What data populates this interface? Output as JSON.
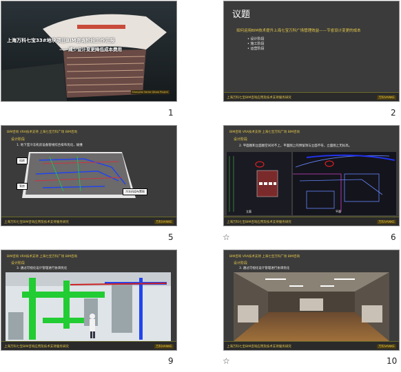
{
  "slides": [
    {
      "number": "1",
      "title_line1": "上海万科七宝33#地块项目BIM咨询阶段工作汇报",
      "title_line2": "——减少设计变更降低成本费用",
      "logo_text": "Shanghai Vanke Qibao Project"
    },
    {
      "number": "2",
      "heading": "议题",
      "subtitle": "如何运用BIM技术提升上海七宝万科广场管理效益——节省设计变更的成本",
      "bullets": [
        "设计阶段",
        "施工阶段",
        "运营阶段"
      ],
      "footer": "上海万科七宝BIM咨询应用及技术支持服务研究",
      "footer_logo": "万科VANKE"
    },
    {
      "number": "5",
      "topbar": "BIM咨询 VRA技术支持 上海七宝万科广场 BIM咨询",
      "section": "设计阶段",
      "note": "1. 地下室冷冻机房设备管线综合排布优化，碰撞",
      "callouts": [
        "机房",
        "泵房",
        "冷冻机组布置图"
      ],
      "footer": "上海万科七宝BIM咨询应用及技术支持服务研究",
      "footer_logo": "万科VANKE"
    },
    {
      "number": "6",
      "topbar": "BIM咨询 VRA技术支持 上海七宝万科广场 BIM咨询",
      "section": "设计阶段",
      "note": "2. 平面图和立面图空间对不上，平面图上的预留洞与立面不符，立面图上无标高。",
      "label_left": "立面",
      "label_right": "平面",
      "footer": "上海万科七宝BIM咨询应用及技术支持服务研究",
      "footer_logo": "万科VANKE"
    },
    {
      "number": "9",
      "topbar": "BIM咨询 VRA技术支持 上海七宝万科广场 BIM咨询",
      "section": "设计阶段",
      "note": "3. 通过可视化设计管理进行协调优化",
      "footer": "上海万科七宝BIM咨询应用及技术支持服务研究",
      "footer_logo": "万科VANKE"
    },
    {
      "number": "10",
      "topbar": "BIM咨询 VRA技术支持 上海七宝万科广场 BIM咨询",
      "section": "设计阶段",
      "note": "3. 通过可视化设计管理进行协调优化",
      "footer": "上海万科七宝BIM咨询应用及技术支持服务研究",
      "footer_logo": "万科VANKE"
    }
  ],
  "transition_star": "☆",
  "colors": {
    "accent_yellow": "#e6c94a",
    "slide_bg": "#3b3b3b",
    "pipe_green": "#22cc33",
    "pipe_blue": "#2244ee"
  }
}
